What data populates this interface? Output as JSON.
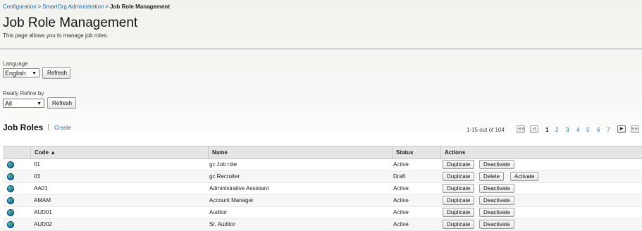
{
  "breadcrumb": {
    "items": [
      "Configuration",
      "SmartOrg Administration"
    ],
    "separator": ">",
    "current": "Job Role Management"
  },
  "page": {
    "title": "Job Role Management",
    "description": "This page allows you to manage job roles."
  },
  "language": {
    "label": "Language",
    "selected": "English",
    "refresh_label": "Refresh"
  },
  "refine": {
    "label": "Really Refine by",
    "selected": "All",
    "refresh_label": "Refresh"
  },
  "section": {
    "title": "Job Roles",
    "create_label": "Create"
  },
  "pagination": {
    "summary": "1-15 out of 104",
    "pages": [
      "1",
      "2",
      "3",
      "4",
      "5",
      "6",
      "7"
    ],
    "current_page": "1",
    "first_icon": "double-left-arrow-icon",
    "prev_icon": "left-arrow-icon",
    "next_icon": "right-arrow-icon",
    "last_icon": "double-right-arrow-icon"
  },
  "table": {
    "headers": {
      "code": "Code ▲",
      "name": "Name",
      "status": "Status",
      "actions": "Actions"
    },
    "rows": [
      {
        "code": "01",
        "name": "gc Job role",
        "status": "Active",
        "actions": [
          "Duplicate",
          "Deactivate"
        ]
      },
      {
        "code": "03",
        "name": "gc Recruiter",
        "status": "Draft",
        "actions": [
          "Duplicate",
          "Delete",
          "Activate"
        ]
      },
      {
        "code": "AA01",
        "name": "Administrative Assistant",
        "status": "Active",
        "actions": [
          "Duplicate",
          "Deactivate"
        ]
      },
      {
        "code": "AMAM",
        "name": "Account Manager",
        "status": "Active",
        "actions": [
          "Duplicate",
          "Deactivate"
        ]
      },
      {
        "code": "AUD01",
        "name": "Auditor",
        "status": "Active",
        "actions": [
          "Duplicate",
          "Deactivate"
        ]
      },
      {
        "code": "AUD02",
        "name": "Sr. Auditor",
        "status": "Active",
        "actions": [
          "Duplicate",
          "Deactivate"
        ]
      }
    ],
    "row_icon": "globe-icon"
  },
  "colors": {
    "link": "#1f6fb5",
    "header_bg": "#e5e5e5"
  }
}
